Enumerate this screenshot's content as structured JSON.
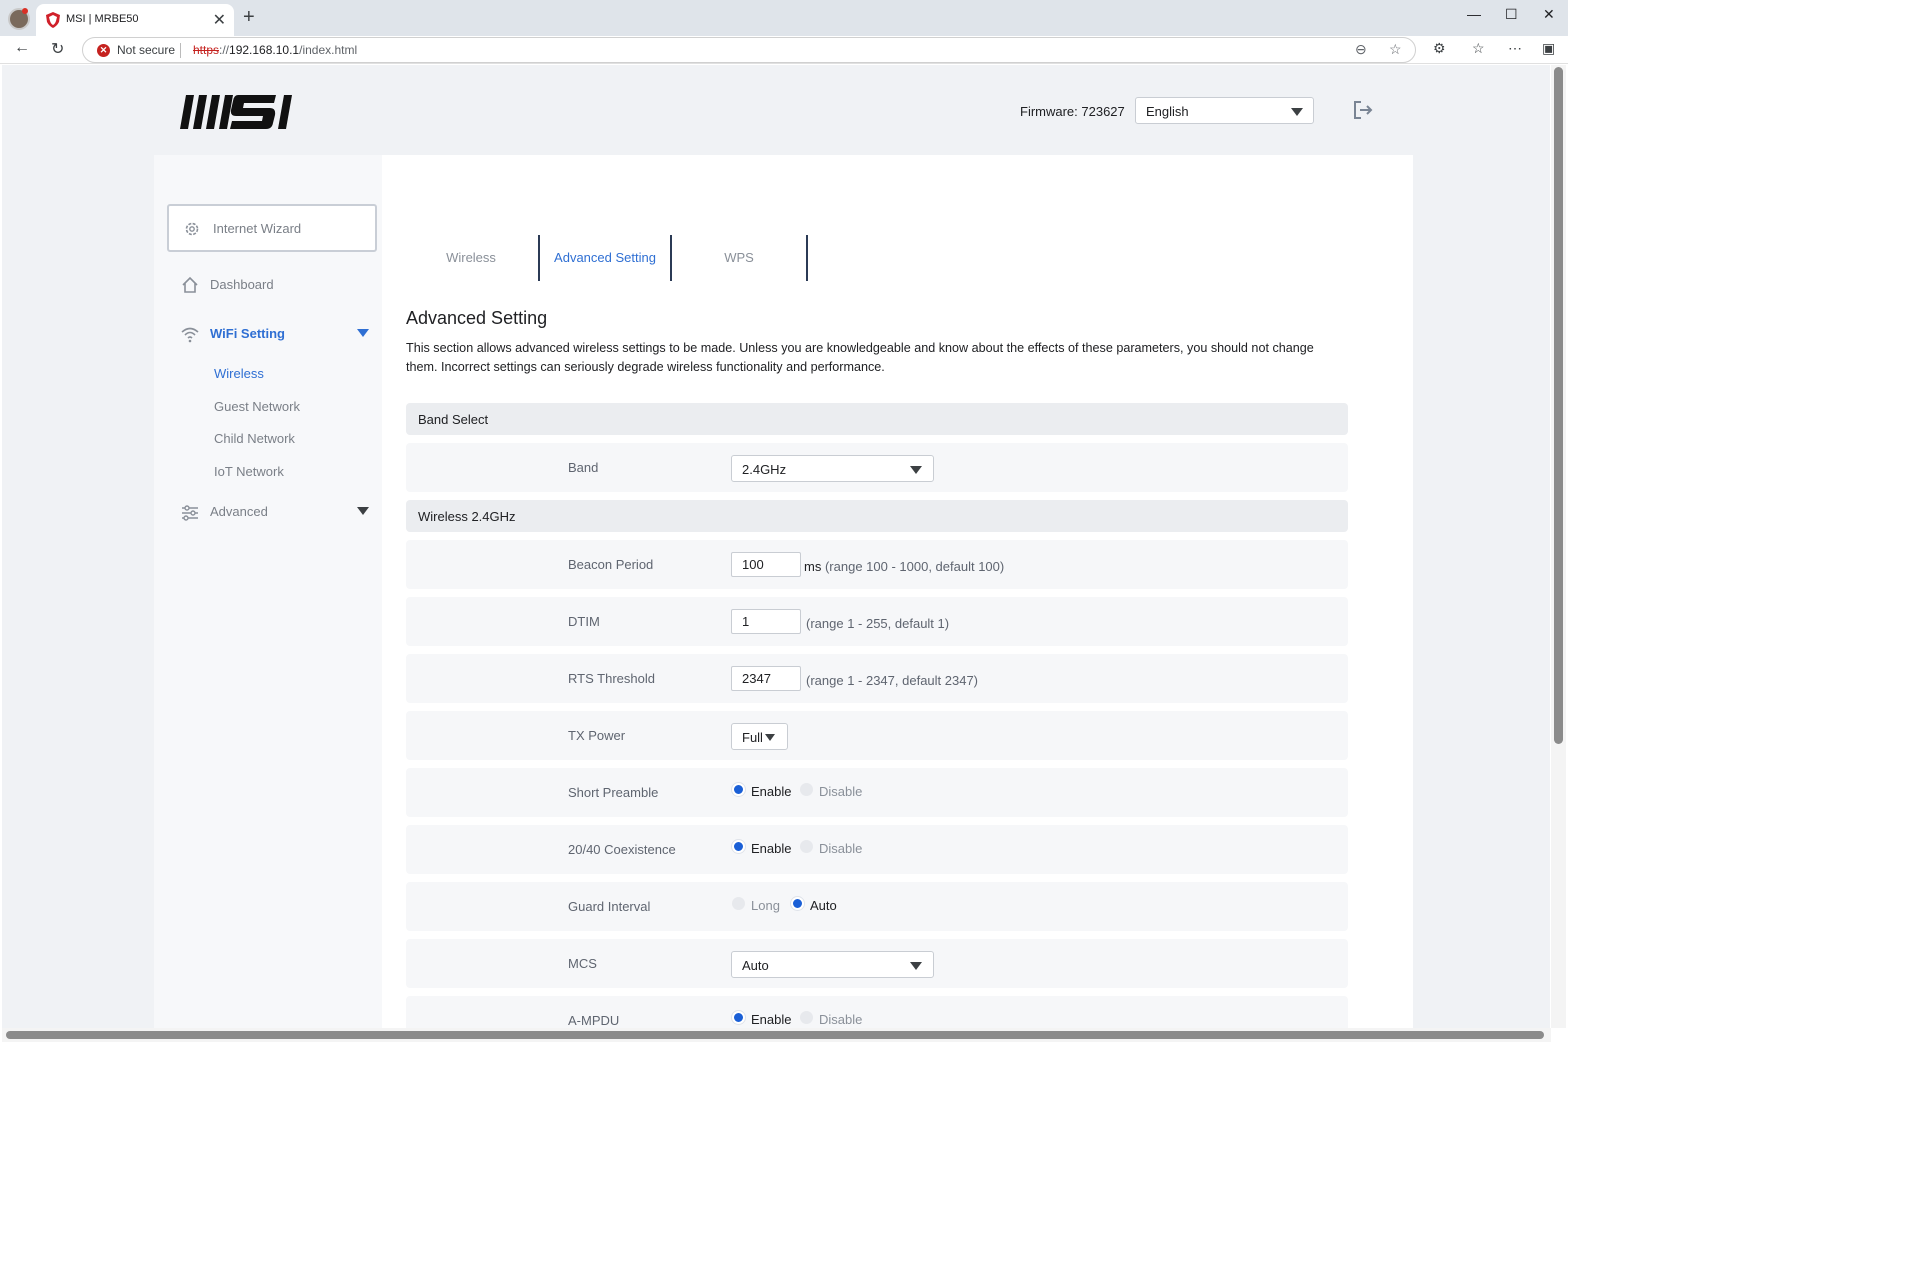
{
  "browser": {
    "tab_title": "MSI | MRBE50",
    "tab_close": "✕",
    "new_tab": "+",
    "security_text": "Not secure",
    "url_scheme": "https",
    "url_host": "192.168.10.1",
    "url_path": "/index.html",
    "window_controls": [
      "—",
      "☐",
      "✕"
    ]
  },
  "header": {
    "logo_text": "MSI",
    "firmware": "Firmware: 723627",
    "language": "English"
  },
  "sidebar": {
    "wizard": "Internet Wizard",
    "dashboard": "Dashboard",
    "wifi_setting": "WiFi Setting",
    "wifi_sub": [
      "Wireless",
      "Guest Network",
      "Child Network",
      "IoT Network"
    ],
    "advanced": "Advanced"
  },
  "tabs": [
    "Wireless",
    "Advanced Setting",
    "WPS"
  ],
  "main": {
    "title": "Advanced Setting",
    "description": "This section allows advanced wireless settings to be made. Unless you are knowledgeable and know about the effects of these parameters, you should not change them. Incorrect settings can seriously degrade wireless functionality and performance.",
    "band_section": "Band Select",
    "band_label": "Band",
    "band_value": "2.4GHz",
    "wireless_section": "Wireless 2.4GHz",
    "beacon": {
      "label": "Beacon Period",
      "value": "100",
      "unit": "ms",
      "hint": "(range 100 - 1000, default 100)"
    },
    "dtim": {
      "label": "DTIM",
      "value": "1",
      "hint": "(range 1 - 255, default 1)"
    },
    "rts": {
      "label": "RTS Threshold",
      "value": "2347",
      "hint": "(range 1 - 2347, default 2347)"
    },
    "tx_power": {
      "label": "TX Power",
      "value": "Full"
    },
    "short_preamble": {
      "label": "Short Preamble",
      "opt1": "Enable",
      "opt2": "Disable"
    },
    "coexistence": {
      "label": "20/40 Coexistence",
      "opt1": "Enable",
      "opt2": "Disable"
    },
    "guard_interval": {
      "label": "Guard Interval",
      "opt1": "Long",
      "opt2": "Auto"
    },
    "mcs": {
      "label": "MCS",
      "value": "Auto"
    },
    "ampdu": {
      "label": "A-MPDU",
      "opt1": "Enable",
      "opt2": "Disable"
    }
  },
  "colors": {
    "accent": "#2f6fd3",
    "radio_selected": "#1a5fd6",
    "insecure": "#c5221f"
  }
}
